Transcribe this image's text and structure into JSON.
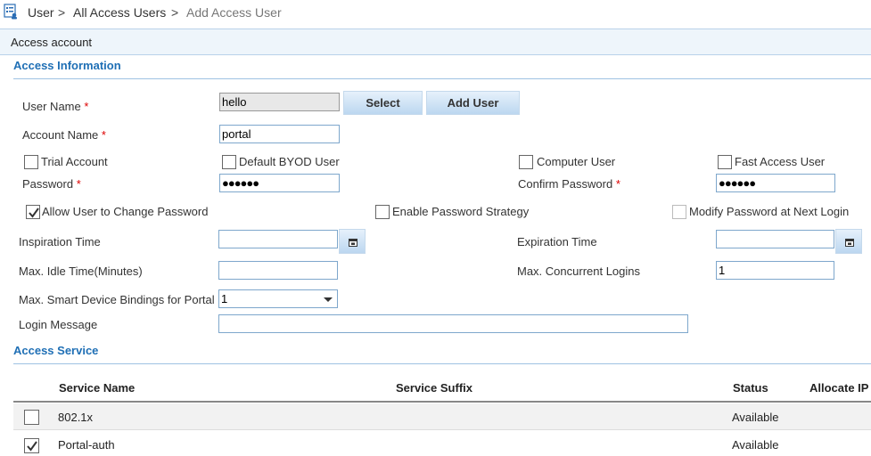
{
  "breadcrumb": {
    "items": [
      "User",
      "All Access Users",
      "Add Access User"
    ],
    "separator": ">"
  },
  "panel": {
    "title": "Access account"
  },
  "access_information": {
    "heading": "Access Information",
    "user_name": {
      "label": "User Name",
      "value": "hello"
    },
    "select_button": "Select",
    "add_user_button": "Add User",
    "account_name": {
      "label": "Account Name",
      "value": "portal"
    },
    "trial_account": {
      "label": "Trial Account",
      "checked": false
    },
    "default_byod_user": {
      "label": "Default BYOD User",
      "checked": false
    },
    "computer_user": {
      "label": "Computer User",
      "checked": false
    },
    "fast_access_user": {
      "label": "Fast Access User",
      "checked": false
    },
    "password": {
      "label": "Password",
      "value": "●●●●●●"
    },
    "confirm_password": {
      "label": "Confirm Password",
      "value": "●●●●●●"
    },
    "allow_change_password": {
      "label": "Allow User to Change Password",
      "checked": true
    },
    "enable_password_strategy": {
      "label": "Enable Password Strategy",
      "checked": false
    },
    "modify_password_next_login": {
      "label": "Modify Password at Next Login",
      "checked": false,
      "disabled": true
    },
    "inspiration_time": {
      "label": "Inspiration Time",
      "value": ""
    },
    "expiration_time": {
      "label": "Expiration Time",
      "value": ""
    },
    "max_idle_time": {
      "label": "Max. Idle Time(Minutes)",
      "value": ""
    },
    "max_concurrent_logins": {
      "label": "Max. Concurrent Logins",
      "value": "1"
    },
    "max_smart_device_bindings": {
      "label": "Max. Smart Device Bindings for Portal",
      "value": "1"
    },
    "login_message": {
      "label": "Login Message",
      "value": ""
    },
    "required_marker": "*"
  },
  "access_service": {
    "heading": "Access Service",
    "columns": [
      "Service Name",
      "Service Suffix",
      "Status",
      "Allocate IP"
    ],
    "rows": [
      {
        "checked": false,
        "service_name": "802.1x",
        "service_suffix": "",
        "status": "Available"
      },
      {
        "checked": true,
        "service_name": "Portal-auth",
        "service_suffix": "",
        "status": "Available"
      }
    ]
  },
  "colors": {
    "section_heading": "#1f6fb5",
    "required": "#dd0000",
    "input_border": "#7ea7cc"
  },
  "icons": {
    "app": "user-list-icon",
    "calendar": "calendar-icon",
    "check": "check-icon",
    "dropdown": "chevron-down-icon"
  }
}
